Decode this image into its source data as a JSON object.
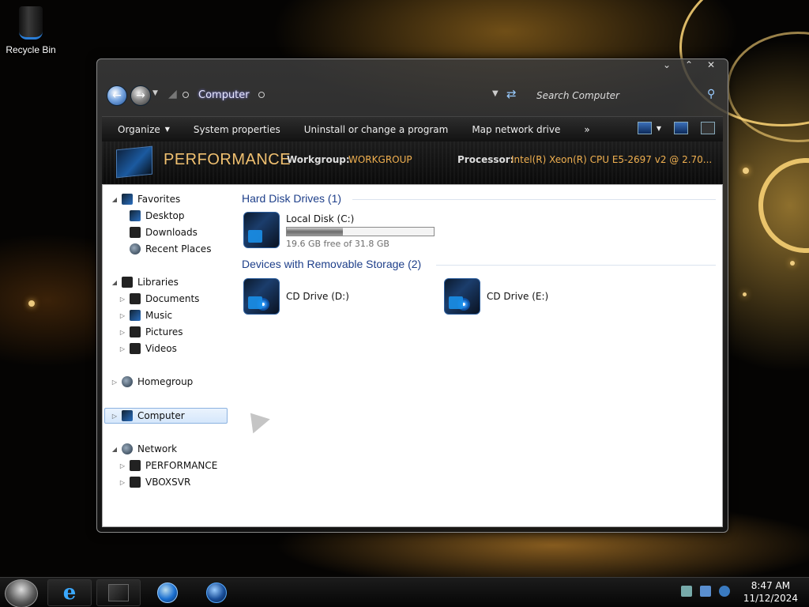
{
  "desktop": {
    "recycle_bin_label": "Recycle Bin"
  },
  "window": {
    "address": "Computer",
    "search_placeholder": "Search Computer",
    "toolbar": {
      "organize": "Organize",
      "system_properties": "System properties",
      "uninstall": "Uninstall or change a program",
      "map_drive": "Map network drive",
      "more": "»"
    },
    "details": {
      "computer_name": "PERFORMANCE",
      "workgroup_label": "Workgroup:",
      "workgroup_value": "WORKGROUP",
      "processor_label": "Processor:",
      "processor_value": "Intel(R) Xeon(R) CPU E5-2697 v2 @ 2.70..."
    },
    "nav": {
      "favorites": "Favorites",
      "desktop": "Desktop",
      "downloads": "Downloads",
      "recent_places": "Recent Places",
      "libraries": "Libraries",
      "documents": "Documents",
      "music": "Music",
      "pictures": "Pictures",
      "videos": "Videos",
      "homegroup": "Homegroup",
      "computer": "Computer",
      "network": "Network",
      "net_performance": "PERFORMANCE",
      "net_vboxsvr": "VBOXSVR"
    },
    "groups": {
      "hard_disks": "Hard Disk Drives (1)",
      "removable": "Devices with Removable Storage (2)"
    },
    "drives": {
      "c_name": "Local Disk (C:)",
      "c_free": "19.6 GB free of 31.8 GB",
      "c_used_fraction": 0.38,
      "d_name": "CD Drive (D:)",
      "e_name": "CD Drive (E:)"
    }
  },
  "taskbar": {
    "time": "8:47 AM",
    "date": "11/12/2024"
  }
}
